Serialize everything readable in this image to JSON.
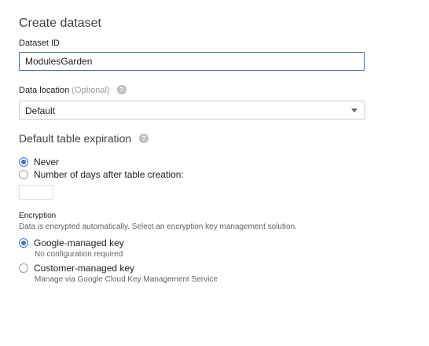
{
  "form": {
    "title": "Create dataset",
    "dataset_id": {
      "label": "Dataset ID",
      "value": "ModulesGarden"
    },
    "data_location": {
      "label": "Data location",
      "optional_text": "(Optional)",
      "help_icon": "question-mark",
      "selected": "Default"
    },
    "expiration": {
      "heading": "Default table expiration",
      "help_icon": "question-mark",
      "options": [
        {
          "label": "Never",
          "checked": true
        },
        {
          "label": "Number of days after table creation:",
          "checked": false
        }
      ],
      "days_value": ""
    },
    "encryption": {
      "heading": "Encryption",
      "description": "Data is encrypted automatically. Select an encryption key management solution.",
      "options": [
        {
          "label": "Google-managed key",
          "sub": "No configuration required",
          "checked": true
        },
        {
          "label": "Customer-managed key",
          "sub": "Manage via Google Cloud Key Management Service",
          "checked": false
        }
      ]
    }
  },
  "colors": {
    "accent": "#3b73d1",
    "input_border": "#3f6fa8",
    "secondary_text": "#5f6368"
  }
}
